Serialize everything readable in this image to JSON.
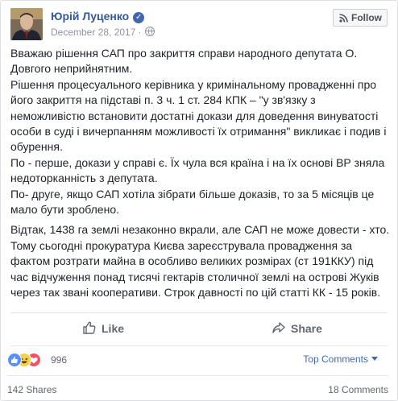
{
  "post": {
    "author": "Юрій Луценко",
    "date": "December 28, 2017",
    "privacy_icon": "globe-icon",
    "verified_icon": "verified-badge-icon",
    "follow_label": "Follow",
    "paragraphs": [
      "Вважаю рішення САП про закриття справи народного депутата О. Довгого неприйнятним.",
      "Рішення процесуального керівника у кримінальному провадженні про його закриття на підставі п. 3 ч. 1 ст. 284 КПК – \"у зв'язку з неможливістю встановити достатні докази для доведення винуватості особи в суді і вичерпанням можливості їх отримання\" викликає і подив і обурення.",
      "По - перше, докази у справі є. Їх чула вся країна і на їх основі ВР зняла недоторканність з депутата.",
      "По- друге, якщо САП хотіла зібрати більше доказів, то за 5 місяців це мало бути зроблено.",
      "Відтак, 1438 га землі незаконно вкрали, але САП не може довести - хто. Тому сьогодні прокуратура Києва зареєструвала провадження за фактом розтрати майна в особливо великих розмірах (ст 191ККУ) під час відчуження понад тисячі гектарів столичної землі на острові Жуків через так звані кооперативи. Строк давності по цій статті КК - 15 років."
    ]
  },
  "actions": {
    "like_label": "Like",
    "share_label": "Share"
  },
  "stats": {
    "reaction_icons": [
      "like-reaction-icon",
      "haha-reaction-icon",
      "love-reaction-icon"
    ],
    "reactions_count": "996",
    "sort_label": "Top Comments",
    "shares": "142 Shares",
    "comments": "18 Comments"
  },
  "colors": {
    "link_blue": "#365899",
    "fb_blue": "#4267b2",
    "muted": "#90949c"
  }
}
